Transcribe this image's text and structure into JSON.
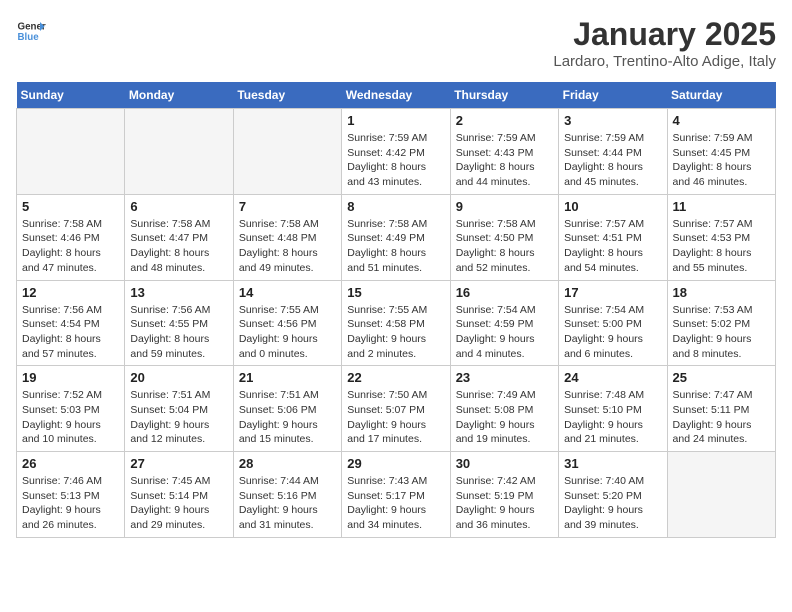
{
  "header": {
    "logo_line1": "General",
    "logo_line2": "Blue",
    "month": "January 2025",
    "location": "Lardaro, Trentino-Alto Adige, Italy"
  },
  "weekdays": [
    "Sunday",
    "Monday",
    "Tuesday",
    "Wednesday",
    "Thursday",
    "Friday",
    "Saturday"
  ],
  "weeks": [
    [
      {
        "day": "",
        "info": ""
      },
      {
        "day": "",
        "info": ""
      },
      {
        "day": "",
        "info": ""
      },
      {
        "day": "1",
        "info": "Sunrise: 7:59 AM\nSunset: 4:42 PM\nDaylight: 8 hours and 43 minutes."
      },
      {
        "day": "2",
        "info": "Sunrise: 7:59 AM\nSunset: 4:43 PM\nDaylight: 8 hours and 44 minutes."
      },
      {
        "day": "3",
        "info": "Sunrise: 7:59 AM\nSunset: 4:44 PM\nDaylight: 8 hours and 45 minutes."
      },
      {
        "day": "4",
        "info": "Sunrise: 7:59 AM\nSunset: 4:45 PM\nDaylight: 8 hours and 46 minutes."
      }
    ],
    [
      {
        "day": "5",
        "info": "Sunrise: 7:58 AM\nSunset: 4:46 PM\nDaylight: 8 hours and 47 minutes."
      },
      {
        "day": "6",
        "info": "Sunrise: 7:58 AM\nSunset: 4:47 PM\nDaylight: 8 hours and 48 minutes."
      },
      {
        "day": "7",
        "info": "Sunrise: 7:58 AM\nSunset: 4:48 PM\nDaylight: 8 hours and 49 minutes."
      },
      {
        "day": "8",
        "info": "Sunrise: 7:58 AM\nSunset: 4:49 PM\nDaylight: 8 hours and 51 minutes."
      },
      {
        "day": "9",
        "info": "Sunrise: 7:58 AM\nSunset: 4:50 PM\nDaylight: 8 hours and 52 minutes."
      },
      {
        "day": "10",
        "info": "Sunrise: 7:57 AM\nSunset: 4:51 PM\nDaylight: 8 hours and 54 minutes."
      },
      {
        "day": "11",
        "info": "Sunrise: 7:57 AM\nSunset: 4:53 PM\nDaylight: 8 hours and 55 minutes."
      }
    ],
    [
      {
        "day": "12",
        "info": "Sunrise: 7:56 AM\nSunset: 4:54 PM\nDaylight: 8 hours and 57 minutes."
      },
      {
        "day": "13",
        "info": "Sunrise: 7:56 AM\nSunset: 4:55 PM\nDaylight: 8 hours and 59 minutes."
      },
      {
        "day": "14",
        "info": "Sunrise: 7:55 AM\nSunset: 4:56 PM\nDaylight: 9 hours and 0 minutes."
      },
      {
        "day": "15",
        "info": "Sunrise: 7:55 AM\nSunset: 4:58 PM\nDaylight: 9 hours and 2 minutes."
      },
      {
        "day": "16",
        "info": "Sunrise: 7:54 AM\nSunset: 4:59 PM\nDaylight: 9 hours and 4 minutes."
      },
      {
        "day": "17",
        "info": "Sunrise: 7:54 AM\nSunset: 5:00 PM\nDaylight: 9 hours and 6 minutes."
      },
      {
        "day": "18",
        "info": "Sunrise: 7:53 AM\nSunset: 5:02 PM\nDaylight: 9 hours and 8 minutes."
      }
    ],
    [
      {
        "day": "19",
        "info": "Sunrise: 7:52 AM\nSunset: 5:03 PM\nDaylight: 9 hours and 10 minutes."
      },
      {
        "day": "20",
        "info": "Sunrise: 7:51 AM\nSunset: 5:04 PM\nDaylight: 9 hours and 12 minutes."
      },
      {
        "day": "21",
        "info": "Sunrise: 7:51 AM\nSunset: 5:06 PM\nDaylight: 9 hours and 15 minutes."
      },
      {
        "day": "22",
        "info": "Sunrise: 7:50 AM\nSunset: 5:07 PM\nDaylight: 9 hours and 17 minutes."
      },
      {
        "day": "23",
        "info": "Sunrise: 7:49 AM\nSunset: 5:08 PM\nDaylight: 9 hours and 19 minutes."
      },
      {
        "day": "24",
        "info": "Sunrise: 7:48 AM\nSunset: 5:10 PM\nDaylight: 9 hours and 21 minutes."
      },
      {
        "day": "25",
        "info": "Sunrise: 7:47 AM\nSunset: 5:11 PM\nDaylight: 9 hours and 24 minutes."
      }
    ],
    [
      {
        "day": "26",
        "info": "Sunrise: 7:46 AM\nSunset: 5:13 PM\nDaylight: 9 hours and 26 minutes."
      },
      {
        "day": "27",
        "info": "Sunrise: 7:45 AM\nSunset: 5:14 PM\nDaylight: 9 hours and 29 minutes."
      },
      {
        "day": "28",
        "info": "Sunrise: 7:44 AM\nSunset: 5:16 PM\nDaylight: 9 hours and 31 minutes."
      },
      {
        "day": "29",
        "info": "Sunrise: 7:43 AM\nSunset: 5:17 PM\nDaylight: 9 hours and 34 minutes."
      },
      {
        "day": "30",
        "info": "Sunrise: 7:42 AM\nSunset: 5:19 PM\nDaylight: 9 hours and 36 minutes."
      },
      {
        "day": "31",
        "info": "Sunrise: 7:40 AM\nSunset: 5:20 PM\nDaylight: 9 hours and 39 minutes."
      },
      {
        "day": "",
        "info": ""
      }
    ]
  ]
}
